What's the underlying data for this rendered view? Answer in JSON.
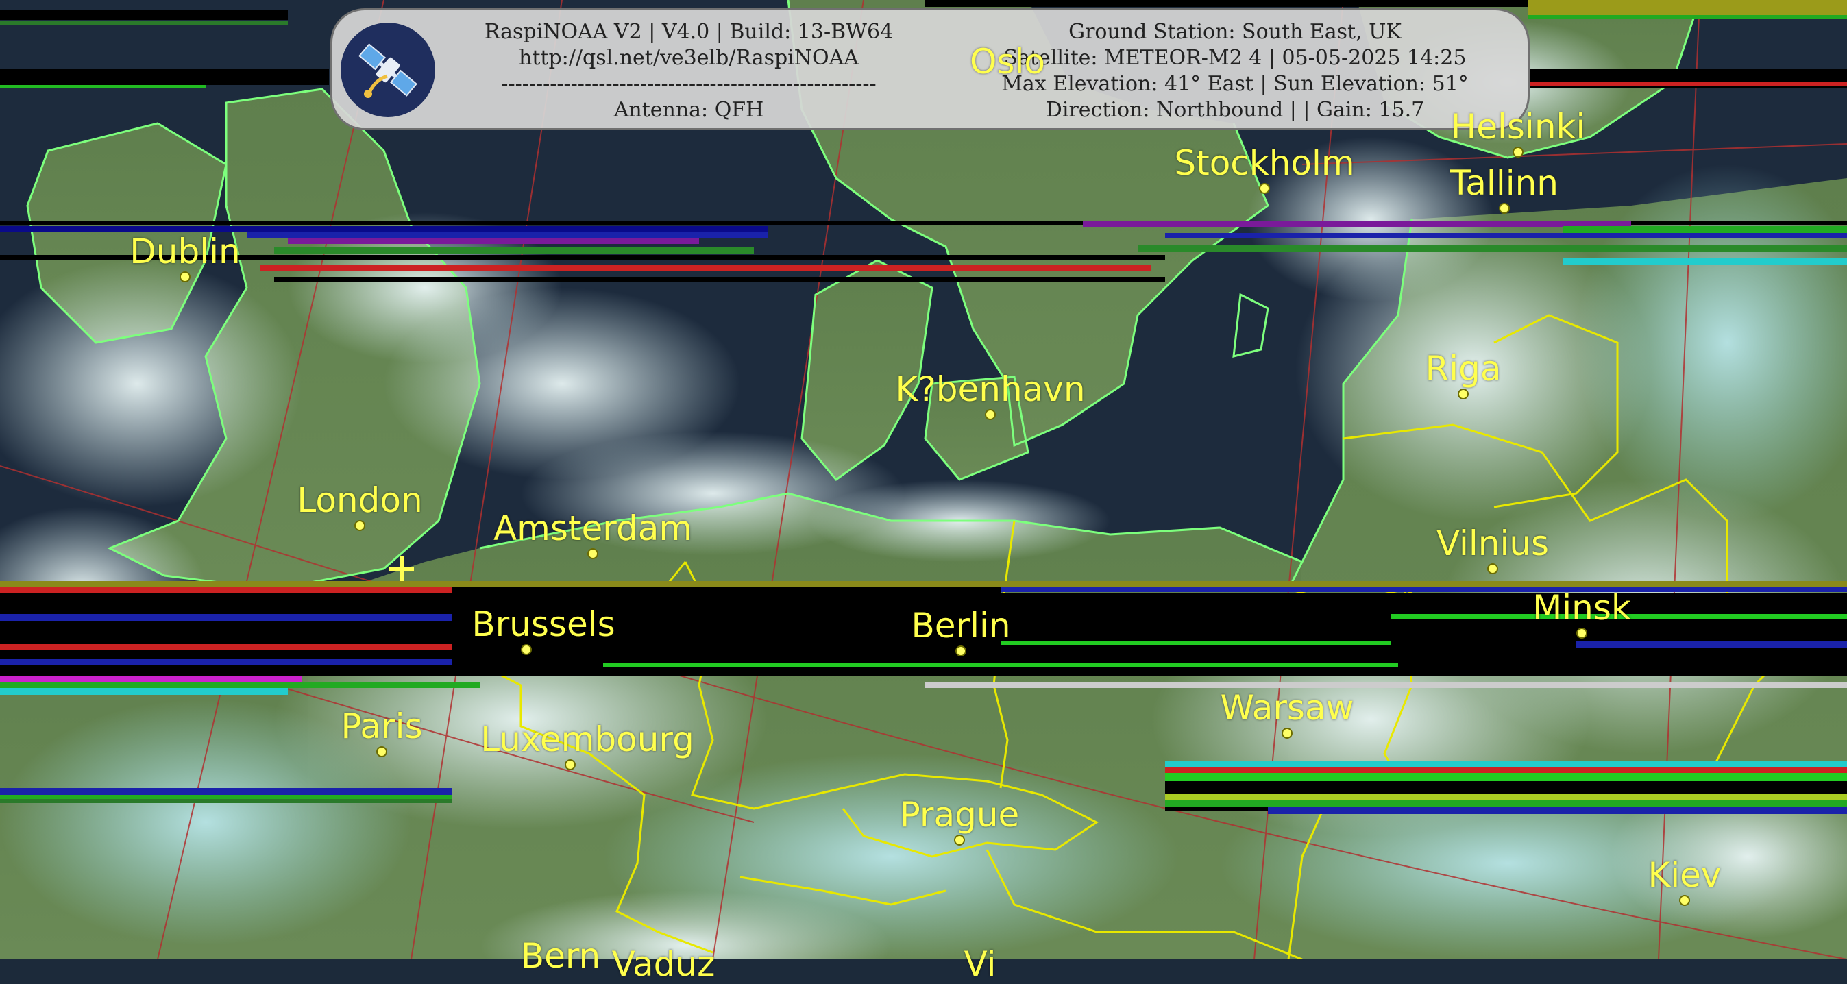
{
  "header": {
    "left": {
      "line1": "RaspiNOAA V2 | V4.0 | Build: 13-BW64",
      "line2": "http://qsl.net/ve3elb/RaspiNOAA",
      "line3": "------------------------------------------------------",
      "line4": "Antenna: QFH"
    },
    "right": {
      "line1": "Ground Station: South East, UK",
      "line2": "Satellite: METEOR-M2 4 | 05-05-2025 14:25",
      "line3": "Max Elevation: 41° East | Sun Elevation: 51°",
      "line4": "Direction: Northbound | | Gain: 15.7"
    },
    "logo_icon": "satellite-icon"
  },
  "cities": [
    {
      "id": "oslo",
      "label": "Oslo"
    },
    {
      "id": "stockholm",
      "label": "Stockholm"
    },
    {
      "id": "helsinki",
      "label": "Helsinki"
    },
    {
      "id": "tallinn",
      "label": "Tallinn"
    },
    {
      "id": "dublin",
      "label": "Dublin"
    },
    {
      "id": "riga",
      "label": "Riga"
    },
    {
      "id": "kobenhavn",
      "label": "K?benhavn"
    },
    {
      "id": "london",
      "label": "London"
    },
    {
      "id": "amsterdam",
      "label": "Amsterdam"
    },
    {
      "id": "vilnius",
      "label": "Vilnius"
    },
    {
      "id": "brussels",
      "label": "Brussels"
    },
    {
      "id": "berlin",
      "label": "Berlin"
    },
    {
      "id": "minsk",
      "label": "Minsk"
    },
    {
      "id": "paris",
      "label": "Paris"
    },
    {
      "id": "luxembourg",
      "label": "Luxembourg"
    },
    {
      "id": "warsaw",
      "label": "Warsaw"
    },
    {
      "id": "prague",
      "label": "Prague"
    },
    {
      "id": "kiev",
      "label": "Kiev"
    },
    {
      "id": "bern",
      "label": "Bern"
    },
    {
      "id": "vaduz",
      "label": "Vaduz"
    },
    {
      "id": "vienna",
      "label": "Vi"
    }
  ],
  "colors": {
    "city_label": "#ffff4d",
    "coastline": "#7dff7d",
    "border": "#e8e800",
    "grid": "#b03030",
    "header_bg": "#d6d6d6"
  }
}
